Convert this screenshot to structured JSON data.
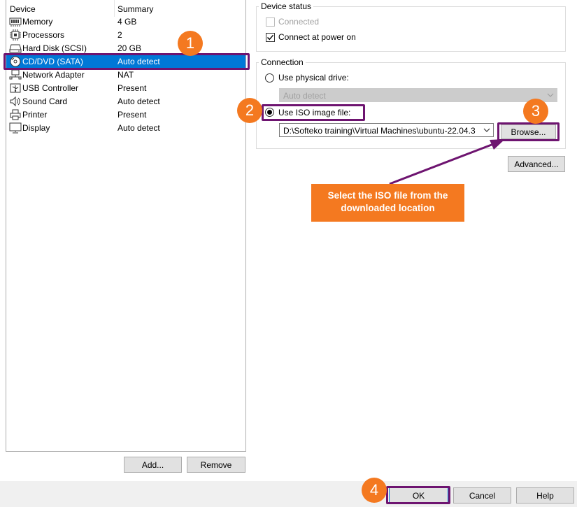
{
  "device_list": {
    "header_device": "Device",
    "header_summary": "Summary",
    "items": [
      {
        "name": "Memory",
        "summary": "4 GB",
        "icon": "memory-icon"
      },
      {
        "name": "Processors",
        "summary": "2",
        "icon": "processor-icon"
      },
      {
        "name": "Hard Disk (SCSI)",
        "summary": "20 GB",
        "icon": "hard-disk-icon"
      },
      {
        "name": "CD/DVD (SATA)",
        "summary": "Auto detect",
        "icon": "cd-dvd-icon",
        "selected": true
      },
      {
        "name": "Network Adapter",
        "summary": "NAT",
        "icon": "network-adapter-icon"
      },
      {
        "name": "USB Controller",
        "summary": "Present",
        "icon": "usb-icon"
      },
      {
        "name": "Sound Card",
        "summary": "Auto detect",
        "icon": "speaker-icon"
      },
      {
        "name": "Printer",
        "summary": "Present",
        "icon": "printer-icon"
      },
      {
        "name": "Display",
        "summary": "Auto detect",
        "icon": "display-icon"
      }
    ]
  },
  "list_buttons": {
    "add": "Add...",
    "remove": "Remove"
  },
  "device_status": {
    "title": "Device status",
    "connected_label": "Connected",
    "connected_checked": false,
    "connected_enabled": false,
    "connect_power_label": "Connect at power on",
    "connect_power_checked": true
  },
  "connection": {
    "title": "Connection",
    "physical_label": "Use physical drive:",
    "physical_value": "Auto detect",
    "iso_label": "Use ISO image file:",
    "iso_selected": true,
    "iso_path": "D:\\Softeko training\\Virtual Machines\\ubuntu-22.04.3",
    "browse": "Browse..."
  },
  "advanced": "Advanced...",
  "footer": {
    "ok": "OK",
    "cancel": "Cancel",
    "help": "Help"
  },
  "annotations": {
    "badge1": "1",
    "badge2": "2",
    "badge3": "3",
    "badge4": "4",
    "callout": "Select the ISO file from the downloaded location"
  },
  "colors": {
    "selection": "#0078d7",
    "annotation_orange": "#f47920",
    "highlight_purple": "#6e1470"
  }
}
